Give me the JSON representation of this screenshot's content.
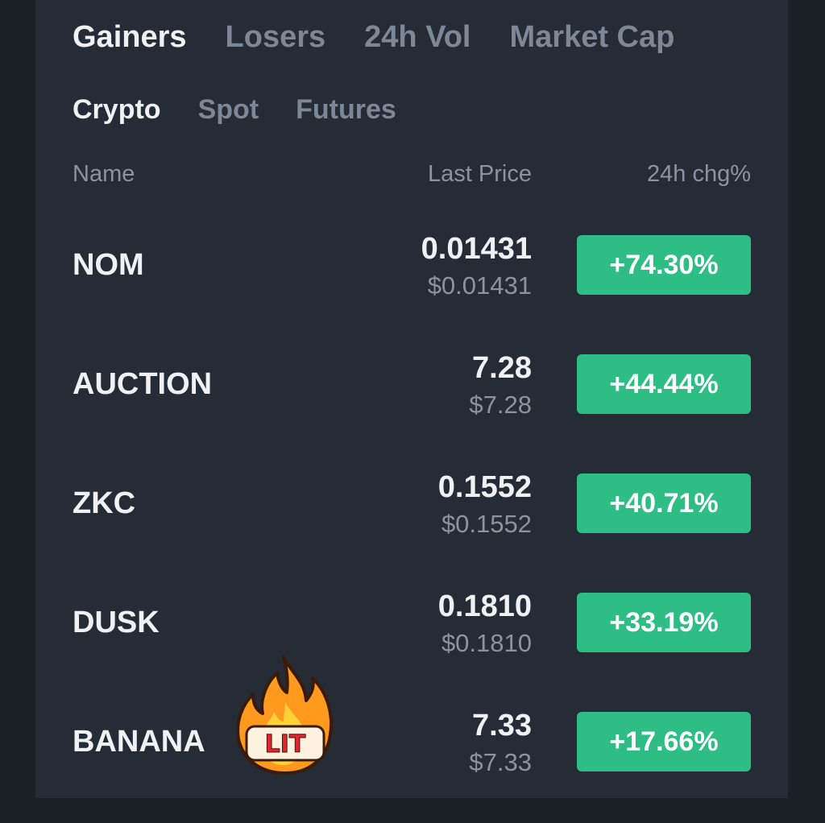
{
  "tabs": {
    "main": [
      {
        "label": "Gainers",
        "active": true
      },
      {
        "label": "Losers",
        "active": false
      },
      {
        "label": "24h Vol",
        "active": false
      },
      {
        "label": "Market Cap",
        "active": false
      }
    ],
    "sub": [
      {
        "label": "Crypto",
        "active": true
      },
      {
        "label": "Spot",
        "active": false
      },
      {
        "label": "Futures",
        "active": false
      }
    ]
  },
  "columns": {
    "name": "Name",
    "last_price": "Last Price",
    "change": "24h chg%"
  },
  "rows": [
    {
      "name": "NOM",
      "last_price": "0.01431",
      "usd_price": "$0.01431",
      "change": "+74.30%"
    },
    {
      "name": "AUCTION",
      "last_price": "7.28",
      "usd_price": "$7.28",
      "change": "+44.44%"
    },
    {
      "name": "ZKC",
      "last_price": "0.1552",
      "usd_price": "$0.1552",
      "change": "+40.71%"
    },
    {
      "name": "DUSK",
      "last_price": "0.1810",
      "usd_price": "$0.1810",
      "change": "+33.19%"
    },
    {
      "name": "BANANA",
      "last_price": "7.33",
      "usd_price": "$7.33",
      "change": "+17.66%"
    }
  ],
  "sticker": {
    "icon": "fire-icon",
    "text": "LIT"
  },
  "colors": {
    "background": "#1b1f26",
    "panel": "#262c36",
    "positive": "#2ebd85",
    "text_primary": "#eef1f5",
    "text_secondary": "#8a93a0"
  }
}
